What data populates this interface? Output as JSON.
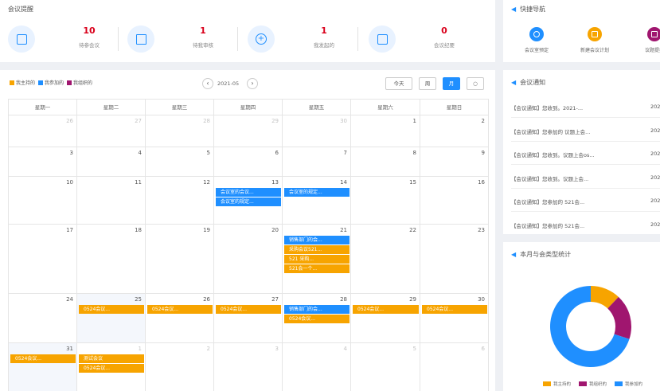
{
  "remind": {
    "title": "会议提醒",
    "stats": [
      {
        "num": "10",
        "label": "待参会议"
      },
      {
        "num": "1",
        "label": "待我审核"
      },
      {
        "num": "1",
        "label": "我发起的"
      },
      {
        "num": "0",
        "label": "会议纪要"
      }
    ]
  },
  "quick": {
    "title": "快捷导航",
    "items": [
      {
        "label": "会议室预定",
        "color": "#1f8fff"
      },
      {
        "label": "新建会议计划",
        "color": "#f7a400"
      },
      {
        "label": "议题提报",
        "color": "#a0166f"
      }
    ]
  },
  "calendar": {
    "legend": [
      {
        "label": "我主持的",
        "color": "#f7a400"
      },
      {
        "label": "我参加的",
        "color": "#1f8fff"
      },
      {
        "label": "我组织的",
        "color": "#a0166f"
      }
    ],
    "month": "2021-05",
    "prev": "‹",
    "next": "›",
    "views": {
      "today": "今天",
      "week": "周",
      "month": "月",
      "refresh": "○"
    },
    "weekdays": [
      "星期一",
      "星期二",
      "星期三",
      "星期四",
      "星期五",
      "星期六",
      "星期日"
    ],
    "weeks": [
      [
        "26",
        "27",
        "28",
        "29",
        "30",
        "1",
        "2"
      ],
      [
        "3",
        "4",
        "5",
        "6",
        "7",
        "8",
        "9"
      ],
      [
        "10",
        "11",
        "12",
        "13",
        "14",
        "15",
        "16"
      ],
      [
        "17",
        "18",
        "19",
        "20",
        "21",
        "22",
        "23"
      ],
      [
        "24",
        "25",
        "26",
        "27",
        "28",
        "29",
        "30"
      ],
      [
        "31",
        "1",
        "2",
        "3",
        "4",
        "5",
        "6"
      ]
    ],
    "events": [
      {
        "week": 2,
        "day": 3,
        "slot": 0,
        "text": "会议室的会议...",
        "color": "blue"
      },
      {
        "week": 2,
        "day": 3,
        "slot": 1,
        "text": "会议室的规定...",
        "color": "blue"
      },
      {
        "week": 2,
        "day": 4,
        "slot": 0,
        "text": "会议室的规定...",
        "color": "blue"
      },
      {
        "week": 3,
        "day": 4,
        "slot": 0,
        "text": "销售部门的会...",
        "color": "blue"
      },
      {
        "week": 3,
        "day": 4,
        "slot": 1,
        "text": "采购会议521...",
        "color": "orange"
      },
      {
        "week": 3,
        "day": 4,
        "slot": 2,
        "text": "521 采购...",
        "color": "orange"
      },
      {
        "week": 3,
        "day": 4,
        "slot": 3,
        "text": "521会一个...",
        "color": "orange"
      },
      {
        "week": 4,
        "day": 1,
        "slot": 0,
        "text": "0524会议...",
        "color": "orange"
      },
      {
        "week": 4,
        "day": 2,
        "slot": 0,
        "text": "0524会议...",
        "color": "orange"
      },
      {
        "week": 4,
        "day": 3,
        "slot": 0,
        "text": "0524会议...",
        "color": "orange"
      },
      {
        "week": 4,
        "day": 4,
        "slot": 0,
        "text": "销售部门的会...",
        "color": "blue"
      },
      {
        "week": 4,
        "day": 4,
        "slot": 1,
        "text": "0524会议...",
        "color": "orange"
      },
      {
        "week": 4,
        "day": 5,
        "slot": 0,
        "text": "0524会议...",
        "color": "orange"
      },
      {
        "week": 4,
        "day": 6,
        "slot": 0,
        "text": "0524会议...",
        "color": "orange"
      },
      {
        "week": 5,
        "day": 0,
        "slot": 0,
        "text": "0524会议...",
        "color": "orange"
      },
      {
        "week": 5,
        "day": 1,
        "slot": 0,
        "text": "测试会议",
        "color": "orange"
      },
      {
        "week": 5,
        "day": 1,
        "slot": 1,
        "text": "0524会议...",
        "color": "orange"
      }
    ]
  },
  "notice": {
    "title": "会议通知",
    "items": [
      {
        "text": "【会议通知】您收到。2021-...",
        "date": "2021"
      },
      {
        "text": "【会议通知】您参加的 议题上会...",
        "date": "2021"
      },
      {
        "text": "【会议通知】您收到。议题上会os...",
        "date": "2021"
      },
      {
        "text": "【会议通知】您收到。议题上会...",
        "date": "2021"
      },
      {
        "text": "【会议通知】您参加的 521会...",
        "date": "2021"
      },
      {
        "text": "【会议通知】您参加的 521会...",
        "date": "2021"
      }
    ]
  },
  "chart_data": {
    "title": "本月与会类型统计",
    "type": "pie",
    "donut": true,
    "categories": [
      "我主持的",
      "我组织的",
      "我参加的"
    ],
    "values": [
      12,
      18,
      70
    ],
    "colors": [
      "#f7a400",
      "#a0166f",
      "#1f8fff"
    ],
    "legend_position": "bottom"
  }
}
